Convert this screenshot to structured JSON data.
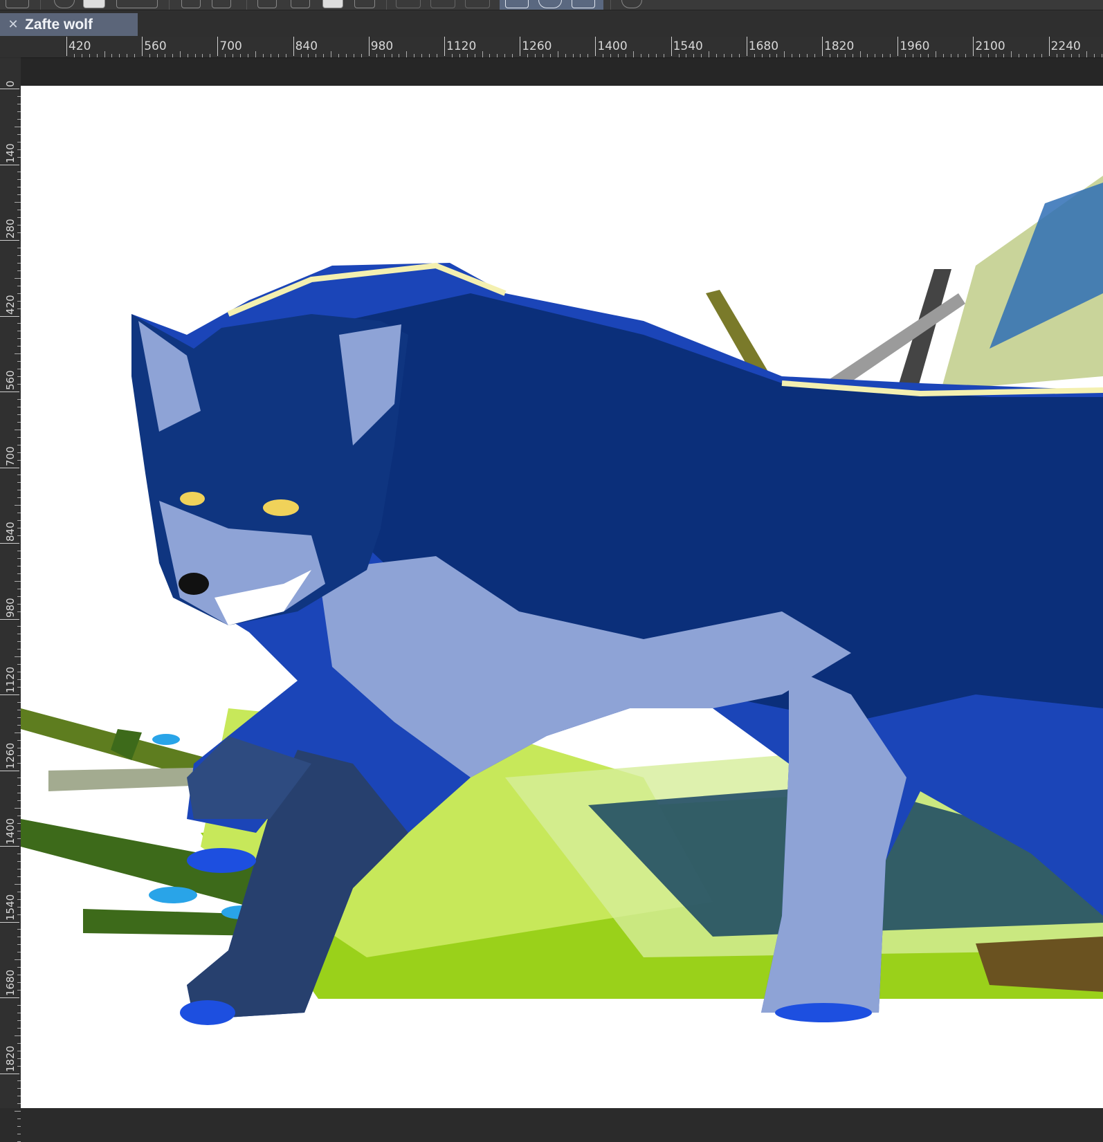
{
  "document": {
    "tab_title": "Zafte wolf",
    "tab_close_icon": "close-icon"
  },
  "toolbar": {
    "icons": [
      "layer-icon",
      "add-layer-icon",
      "fill-icon",
      "dropdown-icon",
      "undo-icon",
      "redo-icon",
      "burst-icon",
      "sparkle-icon",
      "pen-tool-icon",
      "transform-icon",
      "grid-icon",
      "ruler-tool-icon",
      "frame-icon",
      "rect-select-icon",
      "lasso-icon",
      "crop-icon",
      "speech-bubble-icon"
    ]
  },
  "ruler": {
    "horizontal_labels": [
      "420",
      "560",
      "700",
      "840",
      "980",
      "1120",
      "1260",
      "1400",
      "1540",
      "1680",
      "1820",
      "1960",
      "2100",
      "2240"
    ],
    "vertical_labels": [
      "0",
      "140",
      "280",
      "420",
      "560",
      "700",
      "840",
      "980",
      "1120",
      "1260",
      "1400",
      "1540",
      "1680",
      "1820"
    ]
  },
  "colors": {
    "ui_dark": "#2b2b2b",
    "tab_active": "#5b6579",
    "wolf_dark_blue": "#0b2f7a",
    "wolf_mid_blue": "#1b45b8",
    "wolf_light_blue": "#8ea3d6",
    "grass_green": "#9ad11a",
    "eye_yellow": "#f0d25a"
  }
}
